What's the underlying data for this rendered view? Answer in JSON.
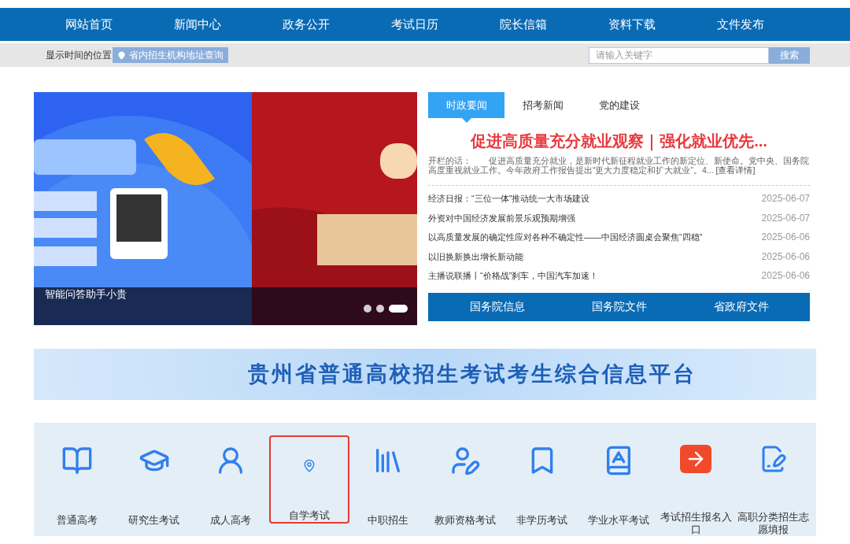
{
  "nav": [
    {
      "label": "网站首页"
    },
    {
      "label": "新闻中心"
    },
    {
      "label": "政务公开"
    },
    {
      "label": "考试日历"
    },
    {
      "label": "院长信箱"
    },
    {
      "label": "资料下载"
    },
    {
      "label": "文件发布"
    }
  ],
  "info_bar": {
    "time_text": "显示时间的位置",
    "address_link": "省内招生机构地址查询",
    "search": {
      "placeholder": "请输入关键字",
      "button": "搜索"
    }
  },
  "carousel": {
    "caption": "智能问答助手小贵",
    "dots": [
      {
        "selected": false
      },
      {
        "selected": false
      },
      {
        "selected": true
      }
    ]
  },
  "news": {
    "tabs": [
      {
        "label": "时政要闻",
        "selected": true
      },
      {
        "label": "招考新闻",
        "selected": false
      },
      {
        "label": "党的建设",
        "selected": false
      }
    ],
    "headline": "促进高质量充分就业观察｜强化就业优先...",
    "summary": "开栏的话：　　促进高质量充分就业，是新时代新征程就业工作的新定位、新使命。党中央、国务院高度重视就业工作。今年政府工作报告提出“更大力度稳定和扩大就业”。4...",
    "more_link": "[查看详情]",
    "items": [
      {
        "title": "经济日报：“三位一体”推动统一大市场建设",
        "date": "2025-06-07"
      },
      {
        "title": "外资对中国经济发展前景乐观预期增强",
        "date": "2025-06-07"
      },
      {
        "title": "以高质量发展的确定性应对各种不确定性——中国经济圆桌会聚焦“四稳”",
        "date": "2025-06-06"
      },
      {
        "title": "以旧换新换出增长新动能",
        "date": "2025-06-06"
      },
      {
        "title": "主播说联播丨“价格战”刹车，中国汽车加速！",
        "date": "2025-06-06"
      }
    ],
    "bottom_tabs": [
      {
        "label": "国务院信息"
      },
      {
        "label": "国务院文件"
      },
      {
        "label": "省政府文件"
      }
    ]
  },
  "banner": {
    "title": "贵州省普通高校招生考试考生综合信息平台"
  },
  "services": [
    {
      "label": "普通高考",
      "highlighted": false
    },
    {
      "label": "研究生考试",
      "highlighted": false
    },
    {
      "label": "成人高考",
      "highlighted": false
    },
    {
      "label": "自学考试",
      "highlighted": true
    },
    {
      "label": "中职招生",
      "highlighted": false
    },
    {
      "label": "教师资格考试",
      "highlighted": false
    },
    {
      "label": "非学历考试",
      "highlighted": false
    },
    {
      "label": "学业水平考试",
      "highlighted": false
    },
    {
      "label": "考试招生报名入口",
      "highlighted": false
    },
    {
      "label": "高职分类招生志愿填报",
      "highlighted": false
    }
  ]
}
